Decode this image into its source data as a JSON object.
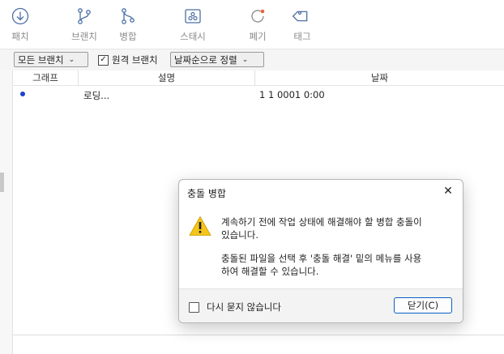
{
  "toolbar": {
    "items": [
      {
        "label": "패치",
        "icon": "patch-icon"
      },
      {
        "label": "브랜치",
        "icon": "branch-icon"
      },
      {
        "label": "병합",
        "icon": "merge-icon"
      },
      {
        "label": "스태시",
        "icon": "stash-icon"
      },
      {
        "label": "폐기",
        "icon": "discard-icon"
      },
      {
        "label": "태그",
        "icon": "tag-icon"
      }
    ]
  },
  "filter": {
    "branch_select": "모든 브랜치",
    "remote_branches_label": "원격 브랜치",
    "remote_branches_checked": true,
    "sort_select": "날짜순으로 정렬"
  },
  "grid": {
    "columns": [
      "그래프",
      "설명",
      "날짜"
    ],
    "rows": [
      {
        "description": "로딩...",
        "date": "1 1 0001 0:00"
      }
    ]
  },
  "dialog": {
    "title": "충돌 병합",
    "message_line1": "계속하기 전에 작업 상태에 해결해야 할 병합 충돌이",
    "message_line2": "있습니다.",
    "message_line3": "충돌된 파일을 선택 후 '충돌 해결' 밑의 메뉴를 사용",
    "message_line4": "하여 해결할 수 있습니다.",
    "dont_ask_label": "다시 묻지 않습니다",
    "close_label": "닫기(C)"
  },
  "colors": {
    "accent": "#0a5fc4",
    "graph_dot": "#1f3fd1",
    "warning": "#f5c518",
    "toolbar_icon": "#4a6fa5"
  }
}
